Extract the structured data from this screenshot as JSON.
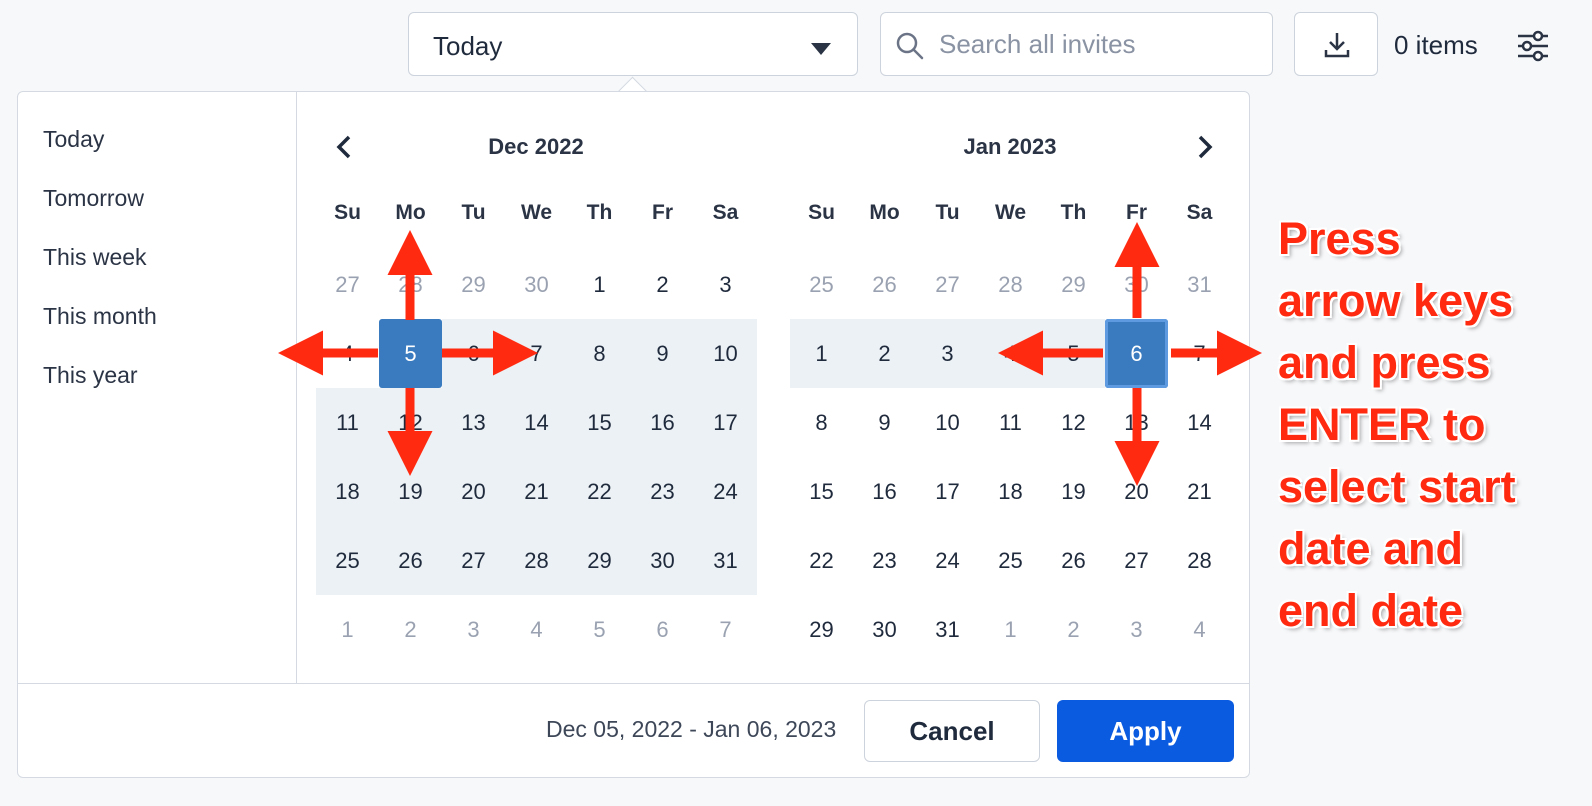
{
  "toolbar": {
    "range_select": "Today",
    "search_placeholder": "Search all invites",
    "items_count": "0 items"
  },
  "presets": [
    "Today",
    "Tomorrow",
    "This week",
    "This month",
    "This year"
  ],
  "weekdays": [
    "Su",
    "Mo",
    "Tu",
    "We",
    "Th",
    "Fr",
    "Sa"
  ],
  "calendar_left": {
    "title": "Dec 2022",
    "rows": [
      [
        "27",
        "28",
        "29",
        "30",
        "1",
        "2",
        "3"
      ],
      [
        "4",
        "5",
        "6",
        "7",
        "8",
        "9",
        "10"
      ],
      [
        "11",
        "12",
        "13",
        "14",
        "15",
        "16",
        "17"
      ],
      [
        "18",
        "19",
        "20",
        "21",
        "22",
        "23",
        "24"
      ],
      [
        "25",
        "26",
        "27",
        "28",
        "29",
        "30",
        "31"
      ],
      [
        "1",
        "2",
        "3",
        "4",
        "5",
        "6",
        "7"
      ]
    ],
    "other_month": [
      [
        0,
        0
      ],
      [
        0,
        1
      ],
      [
        0,
        2
      ],
      [
        0,
        3
      ],
      [
        5,
        0
      ],
      [
        5,
        1
      ],
      [
        5,
        2
      ],
      [
        5,
        3
      ],
      [
        5,
        4
      ],
      [
        5,
        5
      ],
      [
        5,
        6
      ]
    ],
    "selected": [
      [
        1,
        1
      ]
    ],
    "in_range_from": [
      1,
      1
    ]
  },
  "calendar_right": {
    "title": "Jan 2023",
    "rows": [
      [
        "25",
        "26",
        "27",
        "28",
        "29",
        "30",
        "31"
      ],
      [
        "1",
        "2",
        "3",
        "4",
        "5",
        "6",
        "7"
      ],
      [
        "8",
        "9",
        "10",
        "11",
        "12",
        "13",
        "14"
      ],
      [
        "15",
        "16",
        "17",
        "18",
        "19",
        "20",
        "21"
      ],
      [
        "22",
        "23",
        "24",
        "25",
        "26",
        "27",
        "28"
      ],
      [
        "29",
        "30",
        "31",
        "1",
        "2",
        "3",
        "4"
      ]
    ],
    "other_month": [
      [
        0,
        0
      ],
      [
        0,
        1
      ],
      [
        0,
        2
      ],
      [
        0,
        3
      ],
      [
        0,
        4
      ],
      [
        0,
        5
      ],
      [
        0,
        6
      ],
      [
        5,
        3
      ],
      [
        5,
        4
      ],
      [
        5,
        5
      ],
      [
        5,
        6
      ]
    ],
    "selected": [
      [
        1,
        5
      ]
    ],
    "in_range_to": [
      1,
      5
    ]
  },
  "footer": {
    "range_text": "Dec 05, 2022 - Jan 06, 2023",
    "cancel_label": "Cancel",
    "apply_label": "Apply"
  },
  "annotation": {
    "lines": [
      "Press",
      "arrow keys",
      "and press",
      "ENTER to",
      "select start",
      "date and",
      "end date"
    ],
    "color": "#ff2a10"
  },
  "colors": {
    "selected": "#3a7bbf",
    "range": "#ebf1f5",
    "apply": "#0b5be0"
  }
}
